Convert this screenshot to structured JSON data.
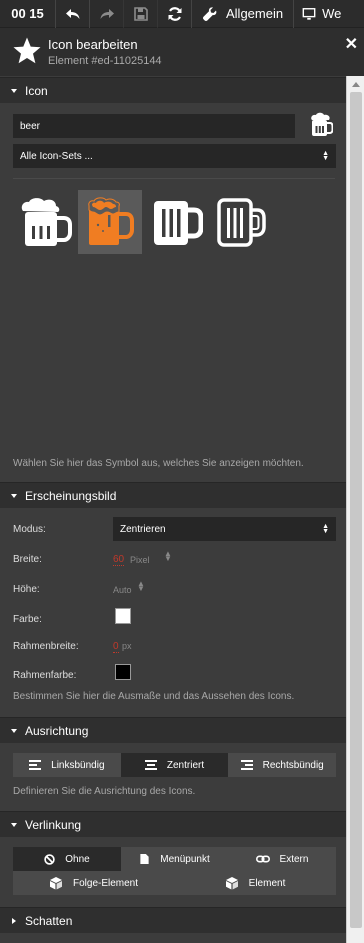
{
  "toolbar": {
    "time": "00 15",
    "settings_label": "Allgemein",
    "cut_label": "We"
  },
  "header": {
    "title": "Icon bearbeiten",
    "subtitle": "Element #ed-11025144"
  },
  "icon_section": {
    "heading": "Icon",
    "search_value": "beer",
    "icon_set": "Alle Icon-Sets ...",
    "help": "Wählen Sie hier das Symbol aus, welches Sie anzeigen möchten.",
    "accent": "#f07d22"
  },
  "appearance": {
    "heading": "Erscheinungsbild",
    "modus_label": "Modus:",
    "modus_value": "Zentrieren",
    "breite_label": "Breite:",
    "breite_value": "60",
    "breite_unit": "Pixel",
    "hoehe_label": "Höhe:",
    "hoehe_value": "Auto",
    "farbe_label": "Farbe:",
    "farbe_color": "#ffffff",
    "rahmenbreite_label": "Rahmenbreite:",
    "rahmenbreite_value": "0",
    "rahmenbreite_unit": "px",
    "rahmenfarbe_label": "Rahmenfarbe:",
    "rahmenfarbe_color": "#000000",
    "help": "Bestimmen Sie hier die Ausmaße und das Aussehen des Icons."
  },
  "alignment": {
    "heading": "Ausrichtung",
    "left": "Linksbündig",
    "center": "Zentriert",
    "right": "Rechtsbündig",
    "help": "Definieren Sie die Ausrichtung des Icons."
  },
  "linking": {
    "heading": "Verlinkung",
    "none": "Ohne",
    "menu": "Menüpunkt",
    "external": "Extern",
    "next": "Folge-Element",
    "element": "Element"
  },
  "shadow": {
    "heading": "Schatten"
  }
}
